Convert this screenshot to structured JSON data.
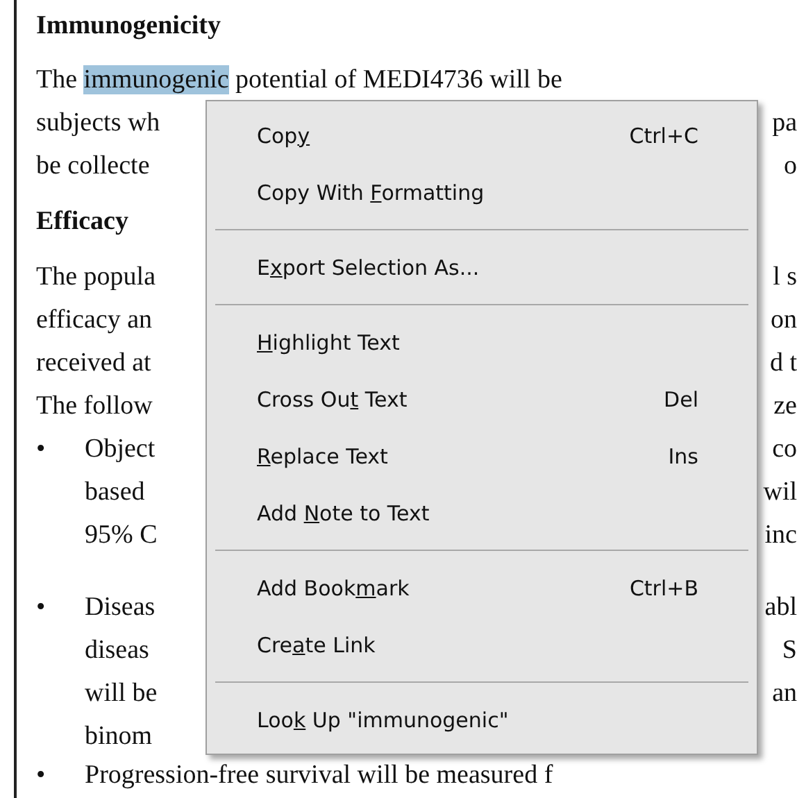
{
  "document": {
    "rows": [
      {
        "kind": "heading",
        "left": "Immunogenicity"
      },
      {
        "kind": "selected-line",
        "left": "The ",
        "selection": "immunogenic",
        "after": " potential of MEDI4736 will be"
      },
      {
        "kind": "line",
        "left": "subjects wh",
        "right": "pa"
      },
      {
        "kind": "line",
        "left": "be collecte",
        "right": "o"
      },
      {
        "kind": "heading",
        "left": "Efficacy"
      },
      {
        "kind": "line",
        "left": "The popula",
        "right": "l s"
      },
      {
        "kind": "line",
        "left": "efficacy an",
        "right": "on"
      },
      {
        "kind": "line",
        "left": "received at",
        "right": "d t"
      },
      {
        "kind": "line",
        "left": "The follow",
        "right": "ze"
      },
      {
        "kind": "bullet",
        "bullet": "•",
        "left": "Object",
        "right": "co"
      },
      {
        "kind": "cont",
        "left": "based",
        "right": "wil"
      },
      {
        "kind": "cont",
        "left": "95% C",
        "right": "inc"
      },
      {
        "kind": "bullet",
        "bullet": "•",
        "left": "Diseas",
        "right": "abl"
      },
      {
        "kind": "cont",
        "left": "diseas",
        "right": "S"
      },
      {
        "kind": "cont",
        "left": "will be",
        "right": "an"
      },
      {
        "kind": "cont",
        "left": "binom"
      },
      {
        "kind": "bullet",
        "bullet": "•",
        "left": "Progression-free survival will be measured f"
      }
    ]
  },
  "context_menu": {
    "items": [
      {
        "kind": "item",
        "before": "Cop",
        "key": "y",
        "shortcut": "Ctrl+C"
      },
      {
        "kind": "item",
        "before": "Copy With ",
        "key": "F",
        "after": "ormatting"
      },
      {
        "kind": "separator"
      },
      {
        "kind": "item",
        "before": "E",
        "key": "x",
        "after": "port Selection As..."
      },
      {
        "kind": "separator"
      },
      {
        "kind": "item",
        "key": "H",
        "after": "ighlight Text"
      },
      {
        "kind": "item",
        "before": "Cross Ou",
        "key": "t",
        "after": " Text",
        "shortcut": "Del"
      },
      {
        "kind": "item",
        "key": "R",
        "after": "eplace Text",
        "shortcut": "Ins"
      },
      {
        "kind": "item",
        "before": "Add ",
        "key": "N",
        "after": "ote to Text"
      },
      {
        "kind": "separator"
      },
      {
        "kind": "item",
        "before": "Add Book",
        "key": "m",
        "after": "ark",
        "shortcut": "Ctrl+B"
      },
      {
        "kind": "item",
        "before": "Cre",
        "key": "a",
        "after": "te Link"
      },
      {
        "kind": "separator"
      },
      {
        "kind": "item",
        "before": "Loo",
        "key": "k",
        "after": " Up \"immunogenic\""
      }
    ]
  }
}
